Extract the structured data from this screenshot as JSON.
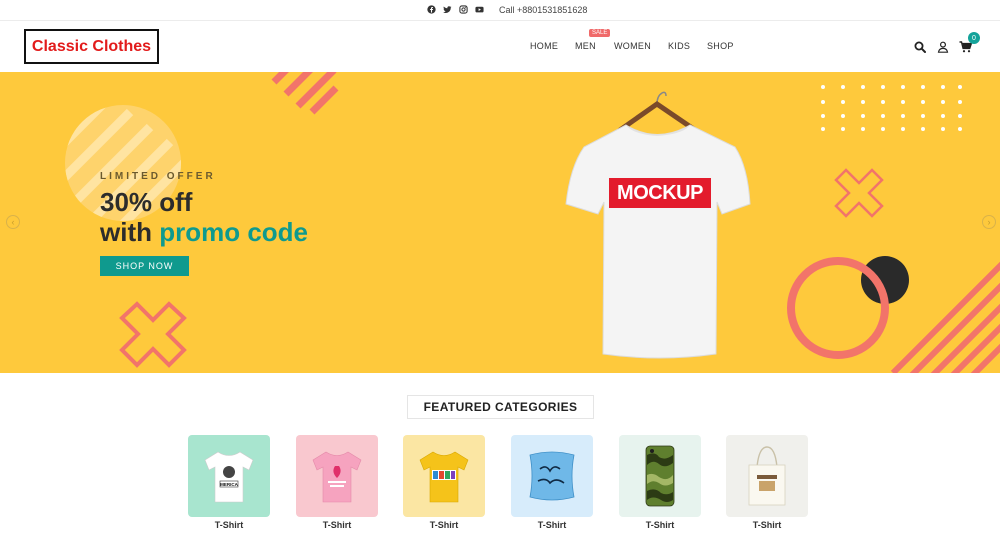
{
  "topbar": {
    "social_icons": [
      "facebook-icon",
      "twitter-icon",
      "instagram-icon",
      "youtube-icon"
    ],
    "phone": "Call +8801531851628"
  },
  "header": {
    "logo": "Classic Clothes",
    "nav": [
      "HOME",
      "MEN",
      "WOMEN",
      "KIDS",
      "SHOP"
    ],
    "sale_badge": "SALE",
    "icons": [
      "search-icon",
      "user-icon",
      "cart-icon"
    ],
    "cart_count": "0"
  },
  "hero": {
    "kicker": "LIMITED OFFER",
    "line1": "30% off",
    "line2_plain": "with ",
    "line2_accent": "promo code",
    "cta": "SHOP NOW",
    "mockup_text": "MOCKUP",
    "arrow_left": "‹",
    "arrow_right": "›"
  },
  "featured": {
    "title": "FEATURED CATEGORIES",
    "categories": [
      {
        "label": "T-Shirt",
        "bg": "#a8e5cf"
      },
      {
        "label": "T-Shirt",
        "bg": "#f9c8cf"
      },
      {
        "label": "T-Shirt",
        "bg": "#fbe6a3"
      },
      {
        "label": "T-Shirt",
        "bg": "#d7ecfb"
      },
      {
        "label": "T-Shirt",
        "bg": "#e7f3ee"
      },
      {
        "label": "T-Shirt",
        "bg": "#f0f0ec"
      }
    ],
    "mini_texts": {
      "merica": "MERICA"
    }
  },
  "colors": {
    "hero_bg": "#fec93c",
    "accent": "#0f9a8e",
    "logo_red": "#e21b1b",
    "coral": "#f2746a"
  }
}
